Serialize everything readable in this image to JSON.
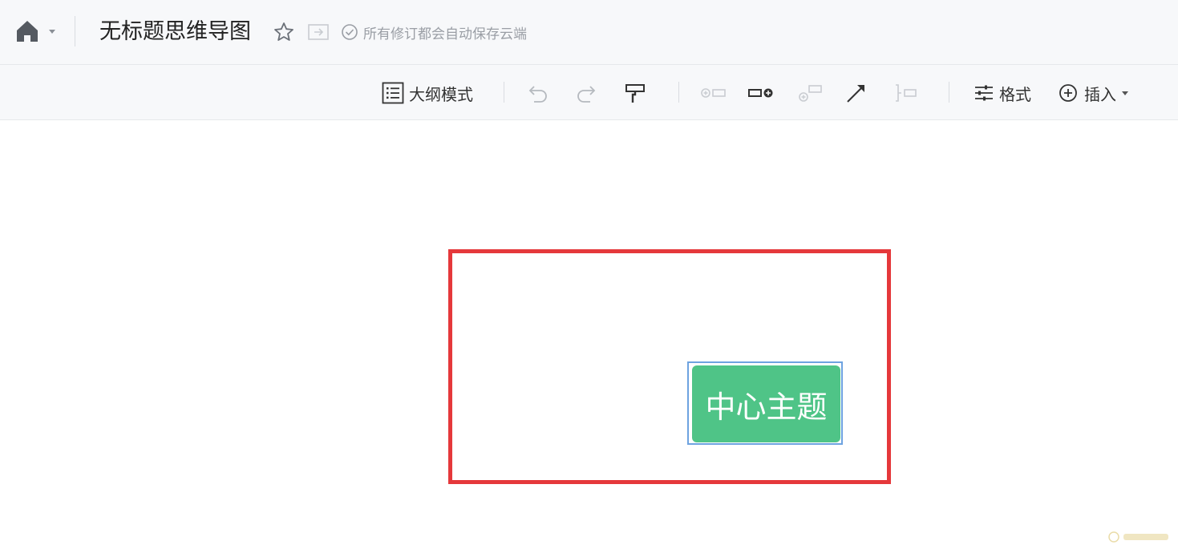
{
  "header": {
    "title": "无标题思维导图",
    "save_status": "所有修订都会自动保存云端"
  },
  "toolbar": {
    "outline_label": "大纲模式",
    "format_label": "格式",
    "insert_label": "插入"
  },
  "canvas": {
    "root_topic": "中心主题"
  },
  "colors": {
    "node_fill": "#4fc487",
    "selection_border": "#6ea3e0",
    "highlight": "#e5383b"
  }
}
